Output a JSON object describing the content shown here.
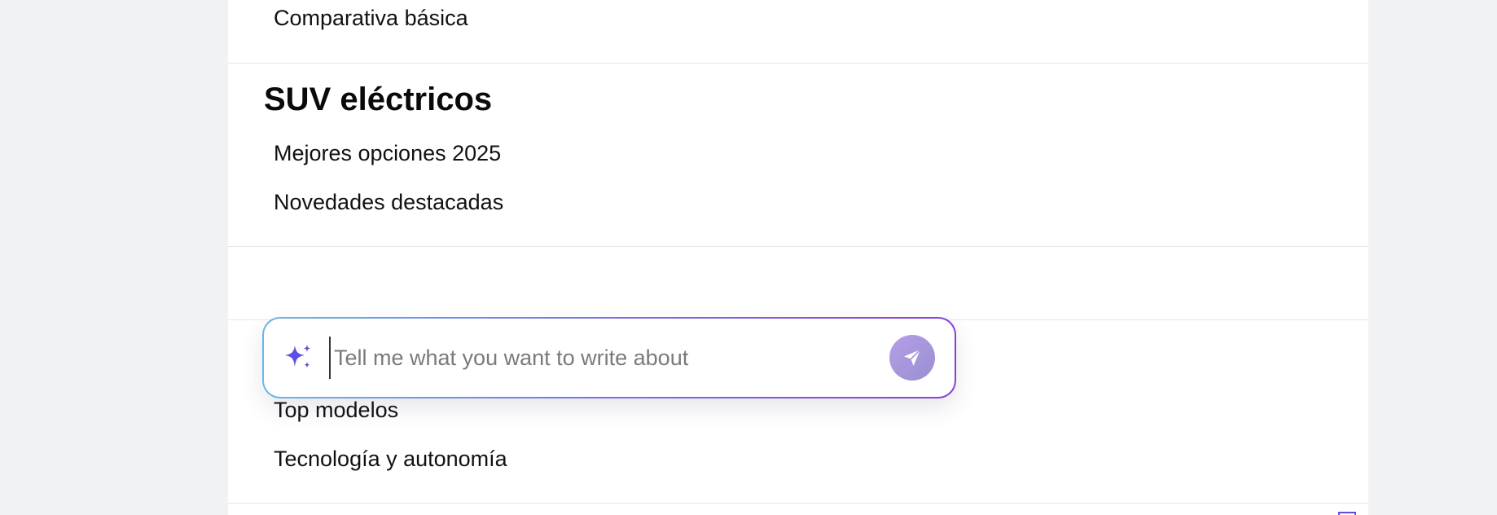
{
  "sections": {
    "previous_item": "Comparativa básica",
    "suv_heading": "SUV eléctricos",
    "suv_items": [
      "Mejores opciones 2025",
      "Novedades destacadas"
    ],
    "next_items": [
      "Top modelos",
      "Tecnología y autonomía"
    ]
  },
  "prompt": {
    "placeholder": "Tell me what you want to write about",
    "value": "",
    "icon": "sparkle-icon",
    "send_icon": "send-icon"
  },
  "colors": {
    "background": "#f1f2f4",
    "sparkle": "#5b4fe6",
    "gradient_start": "#6bb6e6",
    "gradient_end": "#8b3fd8",
    "send_button": "#a997dc"
  }
}
